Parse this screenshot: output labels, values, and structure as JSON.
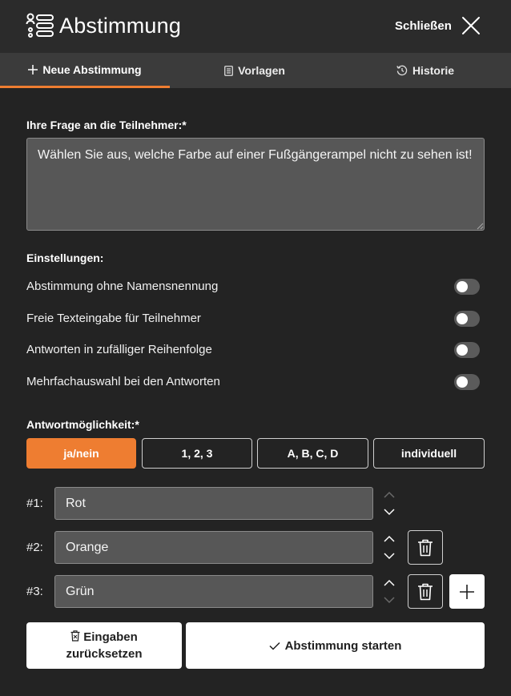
{
  "header": {
    "title": "Abstimmung",
    "close_label": "Schließen",
    "logo_icon": "poll-list-icon",
    "close_icon": "close-icon"
  },
  "tabs": [
    {
      "label": "Neue Abstimmung",
      "icon": "plus-icon",
      "active": true
    },
    {
      "label": "Vorlagen",
      "icon": "template-icon",
      "active": false
    },
    {
      "label": "Historie",
      "icon": "history-icon",
      "active": false
    }
  ],
  "question": {
    "label": "Ihre Frage an die Teilnehmer:*",
    "value": "Wählen Sie aus, welche Farbe auf einer Fußgängerampel nicht zu sehen ist!"
  },
  "settings": {
    "label": "Einstellungen:",
    "items": [
      {
        "label": "Abstimmung ohne Namensnennung",
        "enabled": false
      },
      {
        "label": "Freie Texteingabe für Teilnehmer",
        "enabled": false
      },
      {
        "label": "Antworten in zufälliger Reihenfolge",
        "enabled": false
      },
      {
        "label": "Mehrfachauswahl bei den Antworten",
        "enabled": false
      }
    ]
  },
  "answers": {
    "label": "Antwortmöglichkeit:*",
    "modes": [
      {
        "label": "ja/nein",
        "active": true
      },
      {
        "label": "1, 2, 3",
        "active": false
      },
      {
        "label": "A, B, C, D",
        "active": false
      },
      {
        "label": "individuell",
        "active": false
      }
    ],
    "options": [
      {
        "number": "#1:",
        "value": "Rot"
      },
      {
        "number": "#2:",
        "value": "Orange"
      },
      {
        "number": "#3:",
        "value": "Grün"
      }
    ]
  },
  "actions": {
    "reset_label_line1": "Eingaben",
    "reset_label_line2": "zurücksetzen",
    "start_label": "Abstimmung starten"
  },
  "colors": {
    "accent": "#ee7d31",
    "background": "#232323",
    "field": "#575757"
  }
}
